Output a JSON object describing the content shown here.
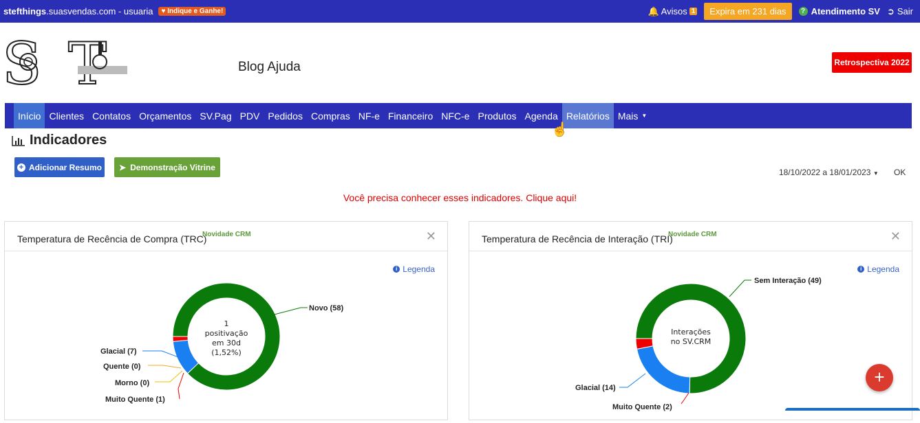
{
  "topbar": {
    "site_bold": "stefthings",
    "site_rest": ".suasvendas.com - usuaria",
    "indique": "Indique e Ganhe!",
    "avisos_label": "Avisos",
    "avisos_count": "1",
    "expira": "Expira em 231 dias",
    "atendimento": "Atendimento SV",
    "sair": "Sair"
  },
  "header": {
    "blog_title": "Blog Ajuda",
    "retrospectiva": "Retrospectiva 2022"
  },
  "nav": {
    "items": [
      "Início",
      "Clientes",
      "Contatos",
      "Orçamentos",
      "SV.Pag",
      "PDV",
      "Pedidos",
      "Compras",
      "NF-e",
      "Financeiro",
      "NFC-e",
      "Produtos",
      "Agenda",
      "Relatórios",
      "Mais"
    ],
    "active": "Início",
    "hovered": "Relatórios"
  },
  "main": {
    "title": "Indicadores",
    "btn_resumo": "Adicionar Resumo",
    "btn_vitrine": "Demonstração Vitrine",
    "date_range": "18/10/2022 a 18/01/2023",
    "ok": "OK",
    "alert": "Você precisa conhecer esses indicadores. Clique aqui!"
  },
  "panels": {
    "trc": {
      "title": "Temperatura de Recência de Compra (TRC)",
      "badge": "Novidade CRM",
      "legenda": "Legenda",
      "center_l1": "1",
      "center_l2": "positivação",
      "center_l3": "em 30d",
      "center_l4": "(1,52%)",
      "labels": {
        "novo": "Novo (58)",
        "glacial": "Glacial (7)",
        "quente": "Quente (0)",
        "morno": "Morno (0)",
        "muito_quente": "Muito Quente (1)"
      }
    },
    "tri": {
      "title": "Temperatura de Recência de Interação (TRI)",
      "badge": "Novidade CRM",
      "legenda": "Legenda",
      "center_l1": "Interações",
      "center_l2": "no SV.CRM",
      "labels": {
        "sem_interacao": "Sem Interação (49)",
        "glacial": "Glacial (14)",
        "muito_quente": "Muito Quente (2)"
      }
    }
  },
  "chart_data": [
    {
      "type": "pie",
      "categories": [
        "Novo",
        "Glacial",
        "Quente",
        "Morno",
        "Muito Quente"
      ],
      "values": [
        58,
        7,
        0,
        0,
        1
      ],
      "colors": [
        "#0a7a0a",
        "#1a7ff0",
        "#f5a623",
        "#f0c000",
        "#ee0000"
      ],
      "title": "Temperatura de Recência de Compra (TRC)"
    },
    {
      "type": "pie",
      "categories": [
        "Sem Interação",
        "Glacial",
        "Muito Quente"
      ],
      "values": [
        49,
        14,
        2
      ],
      "colors": [
        "#0a7a0a",
        "#1a7ff0",
        "#ee0000"
      ],
      "title": "Temperatura de Recência de Interação (TRI)"
    }
  ],
  "colors": {
    "nav_bg": "#2a2fb5",
    "accent_red": "#ee0000",
    "expira_orange": "#f5a623",
    "btn_blue": "#2f5fc7",
    "btn_green": "#6aa23a"
  }
}
